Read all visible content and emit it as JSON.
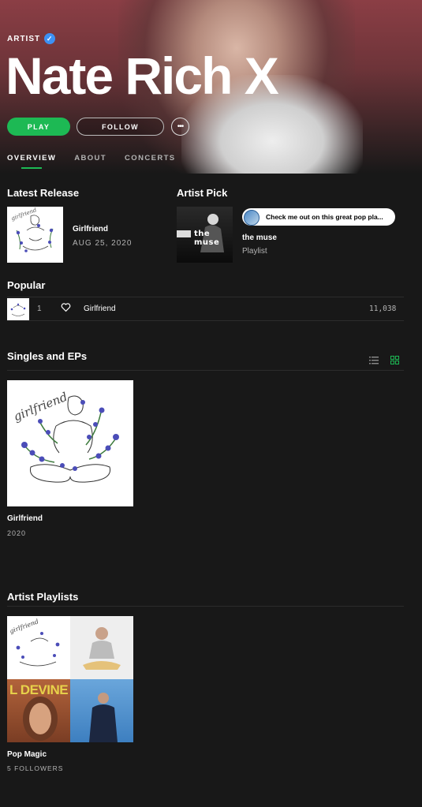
{
  "header": {
    "tag": "ARTIST",
    "name": "Nate Rich X",
    "play_label": "PLAY",
    "follow_label": "FOLLOW",
    "more_label": "•••"
  },
  "tabs": [
    {
      "label": "OVERVIEW",
      "active": true
    },
    {
      "label": "ABOUT",
      "active": false
    },
    {
      "label": "CONCERTS",
      "active": false
    }
  ],
  "latest_release": {
    "section_title": "Latest Release",
    "title": "Girlfriend",
    "date": "AUG 25, 2020"
  },
  "artist_pick": {
    "section_title": "Artist Pick",
    "comment": "Check me out on this great pop pla...",
    "cover_text": "the muse",
    "title": "the muse",
    "type": "Playlist"
  },
  "popular": {
    "section_title": "Popular",
    "tracks": [
      {
        "rank": "1",
        "title": "Girlfriend",
        "plays": "11,038"
      }
    ]
  },
  "singles": {
    "section_title": "Singles and EPs",
    "items": [
      {
        "title": "Girlfriend",
        "year": "2020"
      }
    ]
  },
  "playlists": {
    "section_title": "Artist Playlists",
    "items": [
      {
        "title": "Pop Magic",
        "followers": "5 FOLLOWERS",
        "mosaic_text": "L DEVINE"
      }
    ]
  },
  "colors": {
    "accent": "#1db954",
    "verified": "#3d91f4",
    "background": "#181818"
  }
}
